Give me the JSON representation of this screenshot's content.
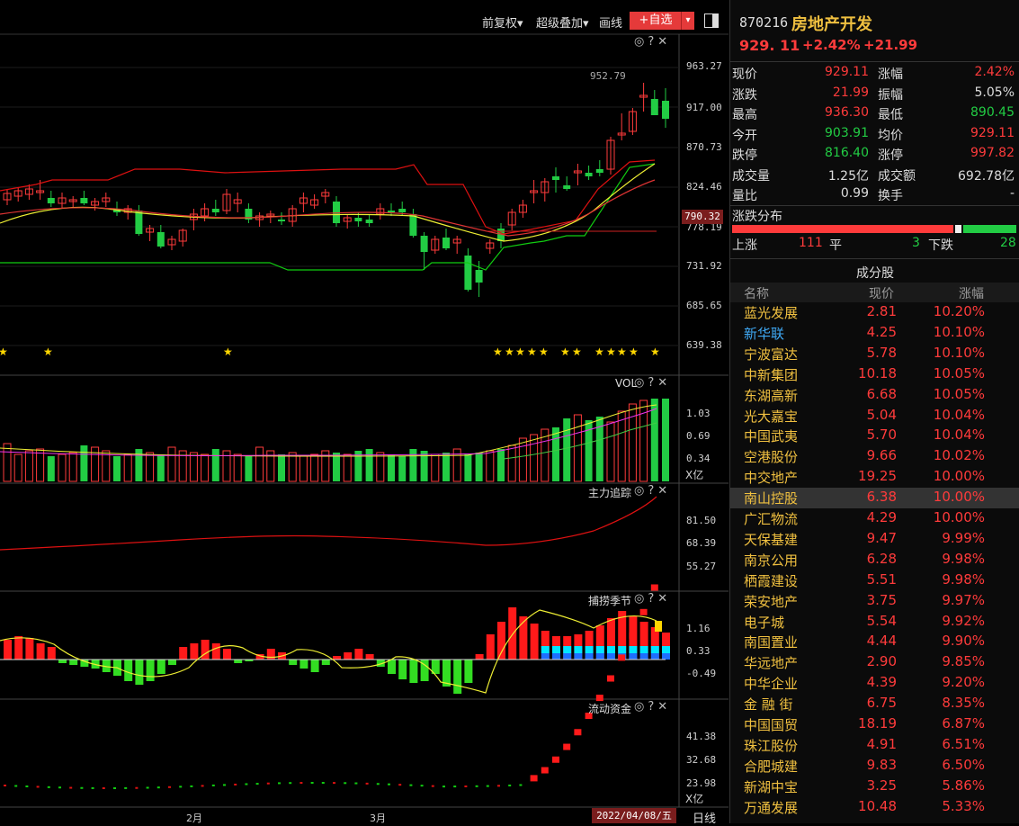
{
  "toolbar": {
    "adjust_label": "前复权▾",
    "overlay_label": "超级叠加▾",
    "draw_label": "画线",
    "add_fav_label": "+自选",
    "add_fav_caret": "▾"
  },
  "main_chart": {
    "price_ticks": [
      "963.27",
      "917.00",
      "870.73",
      "824.46",
      "778.19",
      "731.92",
      "685.65",
      "639.38"
    ],
    "current_price_tag": "790.32",
    "high_label": "952.79",
    "stars_count": 16
  },
  "vol_panel": {
    "title": "VOL",
    "ticks": [
      "1.03",
      "0.69",
      "0.34"
    ],
    "unit": "X亿"
  },
  "main_force_panel": {
    "title": "主力追踪",
    "ticks": [
      "81.50",
      "68.39",
      "55.27"
    ]
  },
  "season_panel": {
    "title": "捕捞季节",
    "ticks": [
      "1.16",
      "0.33",
      "-0.49"
    ]
  },
  "flow_panel": {
    "title": "流动资金",
    "ticks": [
      "41.38",
      "32.68",
      "23.98"
    ],
    "unit": "X亿"
  },
  "xaxis": {
    "month_feb": "2月",
    "month_mar": "3月",
    "date_label": "2022/04/08/五",
    "period": "日线"
  },
  "panel_icons": "◎?✕",
  "header": {
    "code": "870216",
    "name": "房地产开发",
    "price": "929. 11",
    "pct": "+2.42%",
    "chg": "+21.99"
  },
  "quotes": [
    {
      "l1": "现价",
      "v1": "929.11",
      "c1": "#ff3b3b",
      "l2": "涨幅",
      "v2": "2.42%",
      "c2": "#ff3b3b"
    },
    {
      "l1": "涨跌",
      "v1": "21.99",
      "c1": "#ff3b3b",
      "l2": "振幅",
      "v2": "5.05%",
      "c2": "#dddddd"
    },
    {
      "l1": "最高",
      "v1": "936.30",
      "c1": "#ff3b3b",
      "l2": "最低",
      "v2": "890.45",
      "c2": "#22cc44"
    },
    {
      "l1": "今开",
      "v1": "903.91",
      "c1": "#22cc44",
      "l2": "均价",
      "v2": "929.11",
      "c2": "#ff3b3b"
    },
    {
      "l1": "跌停",
      "v1": "816.40",
      "c1": "#22cc44",
      "l2": "涨停",
      "v2": "997.82",
      "c2": "#ff3b3b"
    },
    {
      "l1": "成交量",
      "v1": "1.25亿",
      "c1": "#dddddd",
      "l2": "成交额",
      "v2": "692.78亿",
      "c2": "#dddddd"
    },
    {
      "l1": "量比",
      "v1": "0.99",
      "c1": "#dddddd",
      "l2": "换手",
      "v2": "-",
      "c2": "#dddddd"
    }
  ],
  "distribution": {
    "title": "涨跌分布",
    "up_label": "上涨",
    "up": "111",
    "flat_label": "平",
    "flat": "3",
    "down_label": "下跌",
    "down": "28"
  },
  "constituents": {
    "title": "成分股",
    "head_name": "名称",
    "head_price": "现价",
    "head_pct": "涨幅",
    "rows": [
      {
        "name": "蓝光发展",
        "price": "2.81",
        "pct": "10.20%",
        "color": "#f0c040"
      },
      {
        "name": "新华联",
        "price": "4.25",
        "pct": "10.10%",
        "color": "#3fa9f5"
      },
      {
        "name": "宁波富达",
        "price": "5.78",
        "pct": "10.10%",
        "color": "#f0c040"
      },
      {
        "name": "中新集团",
        "price": "10.18",
        "pct": "10.05%",
        "color": "#f0c040"
      },
      {
        "name": "东湖高新",
        "price": "6.68",
        "pct": "10.05%",
        "color": "#f0c040"
      },
      {
        "name": "光大嘉宝",
        "price": "5.04",
        "pct": "10.04%",
        "color": "#f0c040"
      },
      {
        "name": "中国武夷",
        "price": "5.70",
        "pct": "10.04%",
        "color": "#f0c040"
      },
      {
        "name": "空港股份",
        "price": "9.66",
        "pct": "10.02%",
        "color": "#f0c040"
      },
      {
        "name": "中交地产",
        "price": "19.25",
        "pct": "10.00%",
        "color": "#f0c040"
      },
      {
        "name": "南山控股",
        "price": "6.38",
        "pct": "10.00%",
        "color": "#f0c040"
      },
      {
        "name": "广汇物流",
        "price": "4.29",
        "pct": "10.00%",
        "color": "#f0c040"
      },
      {
        "name": "天保基建",
        "price": "9.47",
        "pct": "9.99%",
        "color": "#f0c040"
      },
      {
        "name": "南京公用",
        "price": "6.28",
        "pct": "9.98%",
        "color": "#f0c040"
      },
      {
        "name": "栖霞建设",
        "price": "5.51",
        "pct": "9.98%",
        "color": "#f0c040"
      },
      {
        "name": "荣安地产",
        "price": "3.75",
        "pct": "9.97%",
        "color": "#f0c040"
      },
      {
        "name": "电子城",
        "price": "5.54",
        "pct": "9.92%",
        "color": "#f0c040"
      },
      {
        "name": "南国置业",
        "price": "4.44",
        "pct": "9.90%",
        "color": "#f0c040"
      },
      {
        "name": "华远地产",
        "price": "2.90",
        "pct": "9.85%",
        "color": "#f0c040"
      },
      {
        "name": "中华企业",
        "price": "4.39",
        "pct": "9.20%",
        "color": "#f0c040"
      },
      {
        "name": "金 融 街",
        "price": "6.75",
        "pct": "8.35%",
        "color": "#f0c040"
      },
      {
        "name": "中国国贸",
        "price": "18.19",
        "pct": "6.87%",
        "color": "#f0c040"
      },
      {
        "name": "珠江股份",
        "price": "4.91",
        "pct": "6.51%",
        "color": "#f0c040"
      },
      {
        "name": "合肥城建",
        "price": "9.83",
        "pct": "6.50%",
        "color": "#f0c040"
      },
      {
        "name": "新湖中宝",
        "price": "3.25",
        "pct": "5.86%",
        "color": "#f0c040"
      },
      {
        "name": "万通发展",
        "price": "10.48",
        "pct": "5.33%",
        "color": "#f0c040"
      }
    ]
  },
  "colors": {
    "up": "#ff3b3b",
    "down": "#22cc44",
    "gold": "#f0c040"
  }
}
